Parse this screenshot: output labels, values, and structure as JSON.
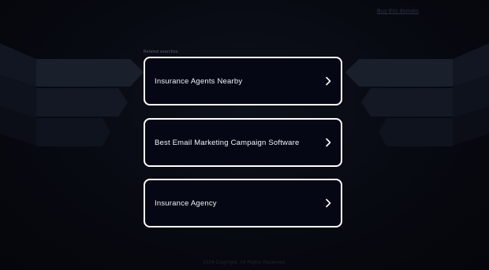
{
  "header": {
    "buy_domain_link": "Buy this domain"
  },
  "related": {
    "label": "Related searches",
    "items": [
      {
        "label": "Insurance Agents Nearby"
      },
      {
        "label": "Best Email Marketing Campaign Software"
      },
      {
        "label": "Insurance Agency"
      }
    ]
  },
  "footer": {
    "text": "2024 Copyright. All Rights Reserved."
  },
  "colors": {
    "background": "#06080f",
    "card_border": "#ffffff",
    "card_fill": "#050814",
    "text": "#f2f4f8"
  },
  "icons": {
    "card_arrow": "chevron-right-icon"
  }
}
